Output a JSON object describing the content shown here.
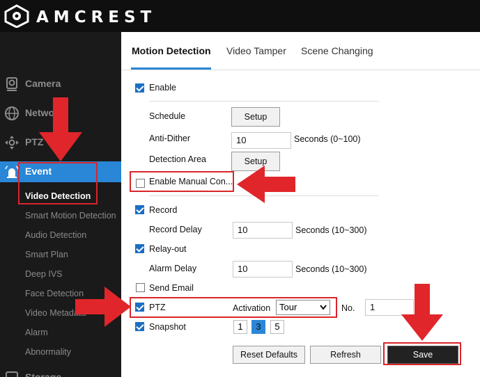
{
  "brand": {
    "name": "AMCREST"
  },
  "sidebar": {
    "camera": "Camera",
    "network": "Network",
    "ptz": "PTZ",
    "event": "Event",
    "storage": "Storage",
    "sub_items": [
      "Video Detection",
      "Smart Motion Detection",
      "Audio Detection",
      "Smart Plan",
      "Deep IVS",
      "Face Detection",
      "Video Metadata",
      "Alarm",
      "Abnormality"
    ]
  },
  "tabs": [
    "Motion Detection",
    "Video Tamper",
    "Scene Changing"
  ],
  "form": {
    "enable": {
      "label": "Enable",
      "checked": true
    },
    "schedule": {
      "label": "Schedule",
      "button": "Setup"
    },
    "anti_dither": {
      "label": "Anti-Dither",
      "value": "10",
      "unit": "Seconds (0~100)"
    },
    "detection_area": {
      "label": "Detection Area",
      "button": "Setup"
    },
    "manual_control": {
      "label": "Enable Manual Con...",
      "checked": false
    },
    "record": {
      "label": "Record",
      "checked": true
    },
    "record_delay": {
      "label": "Record Delay",
      "value": "10",
      "unit": "Seconds (10~300)"
    },
    "relay_out": {
      "label": "Relay-out",
      "checked": true
    },
    "alarm_delay": {
      "label": "Alarm Delay",
      "value": "10",
      "unit": "Seconds (10~300)"
    },
    "send_email": {
      "label": "Send Email",
      "checked": false
    },
    "ptz": {
      "label": "PTZ",
      "checked": true,
      "activation_label": "Activation",
      "activation_value": "Tour",
      "no_label": "No.",
      "no_value": "1"
    },
    "snapshot": {
      "label": "Snapshot",
      "checked": true,
      "options": [
        "1",
        "3",
        "5"
      ],
      "selected": "3"
    }
  },
  "buttons": {
    "reset": "Reset Defaults",
    "refresh": "Refresh",
    "save": "Save"
  },
  "colors": {
    "accent": "#2a86d6",
    "annotation": "#d9252a"
  }
}
